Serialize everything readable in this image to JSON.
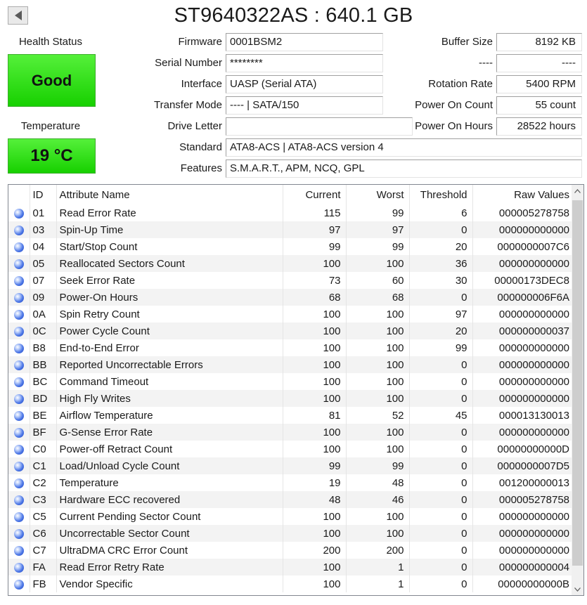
{
  "title": "ST9640322AS : 640.1 GB",
  "health": {
    "label": "Health Status",
    "value": "Good"
  },
  "temperature": {
    "label": "Temperature",
    "value": "19 °C"
  },
  "info_left": [
    {
      "label": "Firmware",
      "value": "0001BSM2"
    },
    {
      "label": "Serial Number",
      "value": "********"
    },
    {
      "label": "Interface",
      "value": "UASP (Serial ATA)"
    },
    {
      "label": "Transfer Mode",
      "value": "---- | SATA/150"
    },
    {
      "label": "Drive Letter",
      "value": ""
    }
  ],
  "info_right": [
    {
      "label": "Buffer Size",
      "value": "8192 KB"
    },
    {
      "label": "----",
      "value": "----"
    },
    {
      "label": "Rotation Rate",
      "value": "5400 RPM"
    },
    {
      "label": "Power On Count",
      "value": "55 count"
    },
    {
      "label": "Power On Hours",
      "value": "28522 hours"
    }
  ],
  "standard": {
    "label": "Standard",
    "value": "ATA8-ACS | ATA8-ACS version 4"
  },
  "features": {
    "label": "Features",
    "value": "S.M.A.R.T., APM, NCQ, GPL"
  },
  "table": {
    "headers": {
      "id": "ID",
      "name": "Attribute Name",
      "current": "Current",
      "worst": "Worst",
      "threshold": "Threshold",
      "raw": "Raw Values"
    },
    "rows": [
      {
        "id": "01",
        "name": "Read Error Rate",
        "current": "115",
        "worst": "99",
        "threshold": "6",
        "raw": "000005278758"
      },
      {
        "id": "03",
        "name": "Spin-Up Time",
        "current": "97",
        "worst": "97",
        "threshold": "0",
        "raw": "000000000000"
      },
      {
        "id": "04",
        "name": "Start/Stop Count",
        "current": "99",
        "worst": "99",
        "threshold": "20",
        "raw": "0000000007C6"
      },
      {
        "id": "05",
        "name": "Reallocated Sectors Count",
        "current": "100",
        "worst": "100",
        "threshold": "36",
        "raw": "000000000000"
      },
      {
        "id": "07",
        "name": "Seek Error Rate",
        "current": "73",
        "worst": "60",
        "threshold": "30",
        "raw": "00000173DEC8"
      },
      {
        "id": "09",
        "name": "Power-On Hours",
        "current": "68",
        "worst": "68",
        "threshold": "0",
        "raw": "000000006F6A"
      },
      {
        "id": "0A",
        "name": "Spin Retry Count",
        "current": "100",
        "worst": "100",
        "threshold": "97",
        "raw": "000000000000"
      },
      {
        "id": "0C",
        "name": "Power Cycle Count",
        "current": "100",
        "worst": "100",
        "threshold": "20",
        "raw": "000000000037"
      },
      {
        "id": "B8",
        "name": "End-to-End Error",
        "current": "100",
        "worst": "100",
        "threshold": "99",
        "raw": "000000000000"
      },
      {
        "id": "BB",
        "name": "Reported Uncorrectable Errors",
        "current": "100",
        "worst": "100",
        "threshold": "0",
        "raw": "000000000000"
      },
      {
        "id": "BC",
        "name": "Command Timeout",
        "current": "100",
        "worst": "100",
        "threshold": "0",
        "raw": "000000000000"
      },
      {
        "id": "BD",
        "name": "High Fly Writes",
        "current": "100",
        "worst": "100",
        "threshold": "0",
        "raw": "000000000000"
      },
      {
        "id": "BE",
        "name": "Airflow Temperature",
        "current": "81",
        "worst": "52",
        "threshold": "45",
        "raw": "000013130013"
      },
      {
        "id": "BF",
        "name": "G-Sense Error Rate",
        "current": "100",
        "worst": "100",
        "threshold": "0",
        "raw": "000000000000"
      },
      {
        "id": "C0",
        "name": "Power-off Retract Count",
        "current": "100",
        "worst": "100",
        "threshold": "0",
        "raw": "00000000000D"
      },
      {
        "id": "C1",
        "name": "Load/Unload Cycle Count",
        "current": "99",
        "worst": "99",
        "threshold": "0",
        "raw": "0000000007D5"
      },
      {
        "id": "C2",
        "name": "Temperature",
        "current": "19",
        "worst": "48",
        "threshold": "0",
        "raw": "001200000013"
      },
      {
        "id": "C3",
        "name": "Hardware ECC recovered",
        "current": "48",
        "worst": "46",
        "threshold": "0",
        "raw": "000005278758"
      },
      {
        "id": "C5",
        "name": "Current Pending Sector Count",
        "current": "100",
        "worst": "100",
        "threshold": "0",
        "raw": "000000000000"
      },
      {
        "id": "C6",
        "name": "Uncorrectable Sector Count",
        "current": "100",
        "worst": "100",
        "threshold": "0",
        "raw": "000000000000"
      },
      {
        "id": "C7",
        "name": "UltraDMA CRC Error Count",
        "current": "200",
        "worst": "200",
        "threshold": "0",
        "raw": "000000000000"
      },
      {
        "id": "FA",
        "name": "Read Error Retry Rate",
        "current": "100",
        "worst": "1",
        "threshold": "0",
        "raw": "000000000004"
      },
      {
        "id": "FB",
        "name": "Vendor Specific",
        "current": "100",
        "worst": "1",
        "threshold": "0",
        "raw": "00000000000B"
      }
    ]
  }
}
